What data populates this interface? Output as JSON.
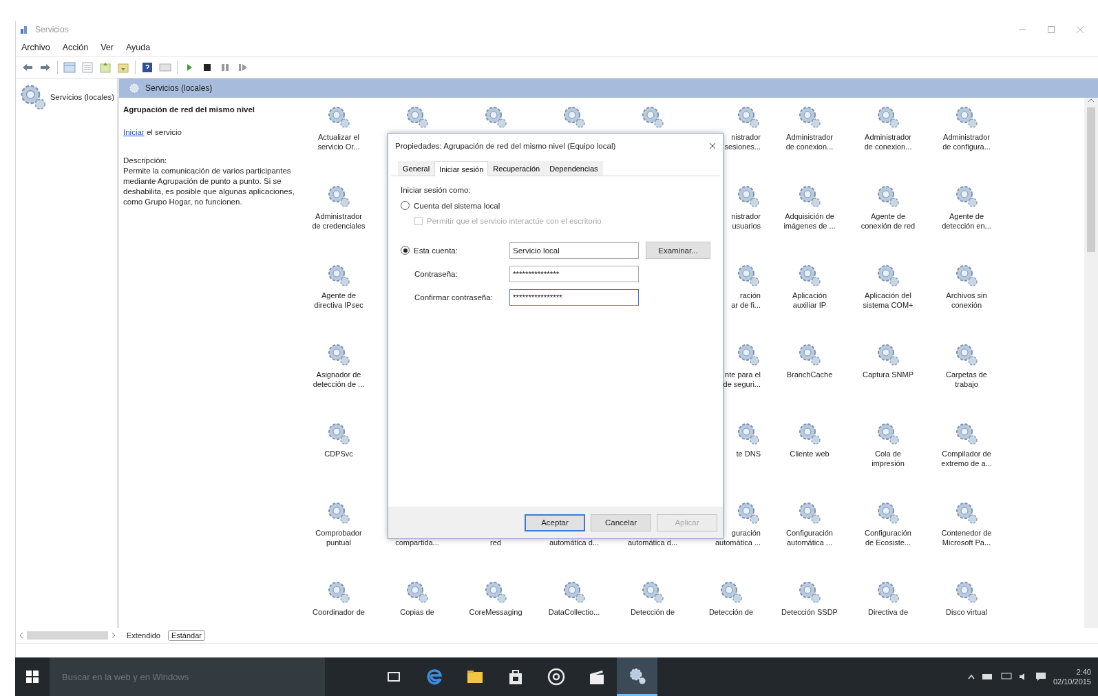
{
  "window": {
    "title": "Servicios"
  },
  "menu": [
    "Archivo",
    "Acción",
    "Ver",
    "Ayuda"
  ],
  "tree": {
    "root": "Servicios (locales)"
  },
  "panel_header": "Servicios (locales)",
  "details": {
    "title": "Agrupación de red del mismo nivel",
    "action_link": "Iniciar",
    "action_rest": " el servicio",
    "description_label": "Descripción:",
    "description": "Permite la comunicación de varios participantes mediante Agrupación de punto a punto. Si se deshabilita, es posible que algunas aplicaciones, como Grupo Hogar, no funcionen."
  },
  "services": [
    [
      {
        "kind": "full",
        "label": "Actualizar el\nservicio Or..."
      },
      {
        "kind": "icon"
      },
      {
        "kind": "icon"
      },
      {
        "kind": "icon"
      },
      {
        "kind": "icon"
      },
      {
        "kind": "partial",
        "label": "nistrador\nsesiones..."
      },
      {
        "kind": "full",
        "label": "Administrador\nde conexion..."
      },
      {
        "kind": "full",
        "label": "Administrador\nde conexion..."
      },
      {
        "kind": "full",
        "label": "Administrador\nde configura..."
      }
    ],
    [
      {
        "kind": "full",
        "label": "Administrador\nde credenciales"
      },
      {
        "kind": "partial",
        "label": "nistrador\nusuarios"
      },
      {
        "kind": "full",
        "label": "Adquisición de\nimágenes de ..."
      },
      {
        "kind": "full",
        "label": "Agente de\nconexión de red"
      },
      {
        "kind": "full",
        "label": "Agente de\ndetección en..."
      }
    ],
    [
      {
        "kind": "full",
        "label": "Agente de\ndirectiva IPsec"
      },
      {
        "kind": "partial",
        "label": "ración\nar de fi..."
      },
      {
        "kind": "full",
        "label": "Aplicación\nauxiliar IP"
      },
      {
        "kind": "full",
        "label": "Aplicación del\nsistema COM+"
      },
      {
        "kind": "full",
        "label": "Archivos sin\nconexión"
      }
    ],
    [
      {
        "kind": "full",
        "label": "Asignador de\ndetección de ..."
      },
      {
        "kind": "partial",
        "label": "nte para el\nde seguri..."
      },
      {
        "kind": "full",
        "label": "BranchCache"
      },
      {
        "kind": "full",
        "label": "Captura SNMP"
      },
      {
        "kind": "full",
        "label": "Carpetas de\ntrabajo"
      }
    ],
    [
      {
        "kind": "full",
        "label": "CDPSvc"
      },
      {
        "kind": "partial",
        "label": "te DNS"
      },
      {
        "kind": "full",
        "label": "Cliente web"
      },
      {
        "kind": "full",
        "label": "Cola de\nimpresión"
      },
      {
        "kind": "full",
        "label": "Compilador de\nextremo de a..."
      }
    ],
    [
      {
        "kind": "full",
        "label": "Comprobador\npuntual"
      },
      {
        "kind": "tail",
        "label": "compartida..."
      },
      {
        "kind": "tail",
        "label": "red"
      },
      {
        "kind": "tail",
        "label": "automática d..."
      },
      {
        "kind": "tail",
        "label": "automática d..."
      },
      {
        "kind": "partial",
        "label": "guración\nautomática ..."
      },
      {
        "kind": "full",
        "label": "Configuración\nautomática ..."
      },
      {
        "kind": "full",
        "label": "Configuración\nde Ecosiste..."
      },
      {
        "kind": "full",
        "label": "Contenedor de\nMicrosoft Pa..."
      }
    ],
    [
      {
        "kind": "full",
        "label": "Coordinador de"
      },
      {
        "kind": "full",
        "label": "Copias de"
      },
      {
        "kind": "full",
        "label": "CoreMessaging"
      },
      {
        "kind": "full",
        "label": "DataCollectio..."
      },
      {
        "kind": "full",
        "label": "Detección de"
      },
      {
        "kind": "full",
        "label": "Detección de"
      },
      {
        "kind": "full",
        "label": "Detección SSDP"
      },
      {
        "kind": "full",
        "label": "Directiva de"
      },
      {
        "kind": "full",
        "label": "Disco virtual"
      }
    ]
  ],
  "view_tabs": [
    {
      "label": "Extendido",
      "selected": false
    },
    {
      "label": "Estándar",
      "selected": true
    }
  ],
  "dialog": {
    "title": "Propiedades: Agrupación de red del mismo nivel (Equipo local)",
    "tabs": [
      {
        "label": "General",
        "selected": false
      },
      {
        "label": "Iniciar sesión",
        "selected": true
      },
      {
        "label": "Recuperación",
        "selected": false
      },
      {
        "label": "Dependencias",
        "selected": false
      }
    ],
    "logon_heading": "Iniciar sesión como:",
    "local_system": {
      "label": "Cuenta del sistema local",
      "selected": false
    },
    "interact": {
      "label": "Permitir que el servicio interactúe con el escritorio",
      "checked": false,
      "disabled": true
    },
    "this_account": {
      "label": "Esta cuenta:",
      "selected": true,
      "value": "Servicio local"
    },
    "browse": "Examinar...",
    "password": {
      "label": "Contraseña:",
      "value": "***************"
    },
    "confirm": {
      "label": "Confirmar contraseña:",
      "value": "****************"
    },
    "buttons": [
      {
        "label": "Aceptar",
        "default": true,
        "disabled": false
      },
      {
        "label": "Cancelar",
        "default": false,
        "disabled": false
      },
      {
        "label": "Aplicar",
        "default": false,
        "disabled": true
      }
    ]
  },
  "taskbar": {
    "search_placeholder": "Buscar en la web y en Windows",
    "apps": [
      {
        "kind": "task-view",
        "active": false
      },
      {
        "kind": "browser",
        "active": false
      },
      {
        "kind": "folder",
        "active": false
      },
      {
        "kind": "store",
        "active": false
      },
      {
        "kind": "media",
        "active": false
      },
      {
        "kind": "clapper",
        "active": false
      },
      {
        "kind": "services",
        "active": true
      }
    ],
    "time": "2:40",
    "date": "02/10/2015"
  }
}
